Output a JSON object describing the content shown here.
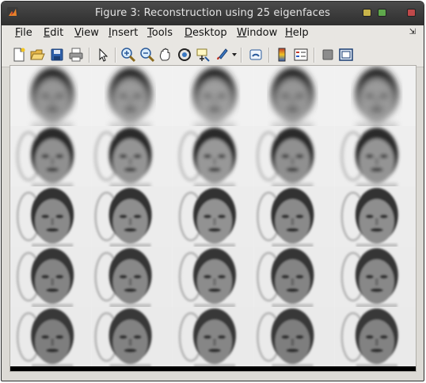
{
  "window": {
    "title": "Figure 3: Reconstruction using 25 eigenfaces"
  },
  "menubar": {
    "items": [
      "File",
      "Edit",
      "View",
      "Insert",
      "Tools",
      "Desktop",
      "Window",
      "Help"
    ],
    "mnemonics": [
      "F",
      "E",
      "V",
      "I",
      "T",
      "D",
      "W",
      "H"
    ]
  },
  "toolbar": {
    "buttons": [
      {
        "icon": "new-figure-icon",
        "tooltip": "New Figure"
      },
      {
        "icon": "open-file-icon",
        "tooltip": "Open File"
      },
      {
        "icon": "save-figure-icon",
        "tooltip": "Save Figure"
      },
      {
        "icon": "print-figure-icon",
        "tooltip": "Print Figure"
      },
      {
        "icon": "edit-plot-arrow-icon",
        "tooltip": "Edit Plot"
      },
      {
        "icon": "zoom-in-icon",
        "tooltip": "Zoom In"
      },
      {
        "icon": "zoom-out-icon",
        "tooltip": "Zoom Out"
      },
      {
        "icon": "pan-hand-icon",
        "tooltip": "Pan"
      },
      {
        "icon": "rotate-3d-icon",
        "tooltip": "Rotate 3D"
      },
      {
        "icon": "data-cursor-icon",
        "tooltip": "Data Cursor"
      },
      {
        "icon": "brush-icon",
        "tooltip": "Brush/Select Data"
      },
      {
        "icon": "link-plot-icon",
        "tooltip": "Link Plot"
      },
      {
        "icon": "colorbar-icon",
        "tooltip": "Insert Colorbar"
      },
      {
        "icon": "legend-icon",
        "tooltip": "Insert Legend"
      },
      {
        "icon": "hide-plot-tools-icon",
        "tooltip": "Hide Plot Tools"
      },
      {
        "icon": "show-plot-tools-icon",
        "tooltip": "Show Plot Tools"
      }
    ]
  },
  "figure": {
    "rows": 5,
    "cols": 5,
    "panels": 25,
    "row_brightness": [
      0.72,
      0.66,
      0.62,
      0.6,
      0.58
    ]
  }
}
